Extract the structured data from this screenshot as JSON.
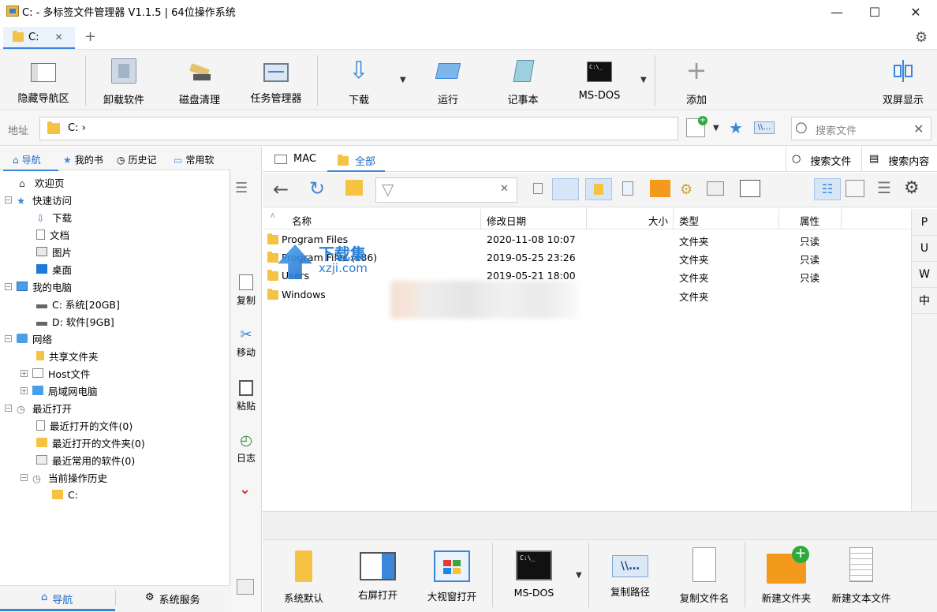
{
  "window": {
    "title": "C: - 多标签文件管理器 V1.1.5 | 64位操作系统",
    "minimize": "—",
    "maximize": "☐",
    "close": "✕"
  },
  "tabs": [
    {
      "label": "C:",
      "close": "✕"
    }
  ],
  "new_tab": "+",
  "toolbar": {
    "hide_nav": "隐藏导航区",
    "uninstall": "卸载软件",
    "disk_clean": "磁盘清理",
    "task_manager": "任务管理器",
    "download": "下载",
    "run": "运行",
    "notepad": "记事本",
    "msdos": "MS-DOS",
    "add": "添加",
    "dual_screen": "双屏显示"
  },
  "address": {
    "label": "地址",
    "path": "C:  ›",
    "search_placeholder": "搜索文件"
  },
  "left_tabs": [
    "导航",
    "我的书",
    "历史记",
    "常用软"
  ],
  "tree": [
    {
      "label": "欢迎页"
    },
    {
      "label": "快速访问"
    },
    {
      "label": "下载"
    },
    {
      "label": "文档"
    },
    {
      "label": "图片"
    },
    {
      "label": "桌面"
    },
    {
      "label": "我的电脑"
    },
    {
      "label": "C: 系统[20GB]"
    },
    {
      "label": "D: 软件[9GB]"
    },
    {
      "label": "网络"
    },
    {
      "label": "共享文件夹"
    },
    {
      "label": "Host文件"
    },
    {
      "label": "局域网电脑"
    },
    {
      "label": "最近打开"
    },
    {
      "label": "最近打开的文件(0)"
    },
    {
      "label": "最近打开的文件夹(0)"
    },
    {
      "label": "最近常用的软件(0)"
    },
    {
      "label": "当前操作历史"
    },
    {
      "label": "C:"
    }
  ],
  "left_bottom": {
    "nav": "导航",
    "system": "系统服务"
  },
  "mid_actions": {
    "copy": "复制",
    "move": "移动",
    "paste": "粘贴",
    "log": "日志"
  },
  "right_tabs": {
    "mac": "MAC",
    "all": "全部",
    "search_files": "搜索文件",
    "search_content": "搜索内容"
  },
  "columns": {
    "name": "名称",
    "modified": "修改日期",
    "size": "大小",
    "type": "类型",
    "attr": "属性"
  },
  "files": [
    {
      "name": "Program Files",
      "modified": "2020-11-08 10:07",
      "type": "文件夹",
      "attr": "只读"
    },
    {
      "name": "Program Files (x86)",
      "modified": "2019-05-25 23:26",
      "type": "文件夹",
      "attr": "只读"
    },
    {
      "name": "Users",
      "modified": "2019-05-21 18:00",
      "type": "文件夹",
      "attr": "只读"
    },
    {
      "name": "Windows",
      "modified": "",
      "type": "文件夹",
      "attr": ""
    }
  ],
  "right_strip": [
    "P",
    "U",
    "W",
    "中"
  ],
  "bottom_toolbar": {
    "system_default": "系统默认",
    "right_open": "右屏打开",
    "big_window": "大视窗打开",
    "msdos": "MS-DOS",
    "copy_path": "复制路径",
    "copy_name": "复制文件名",
    "new_folder": "新建文件夹",
    "new_text": "新建文本文件"
  },
  "watermark": {
    "text": "下载集",
    "url": "xzji.com"
  },
  "colors": {
    "accent": "#3a86d8",
    "folder": "#f6c244",
    "toolbar_bg": "#f4f4f4"
  }
}
